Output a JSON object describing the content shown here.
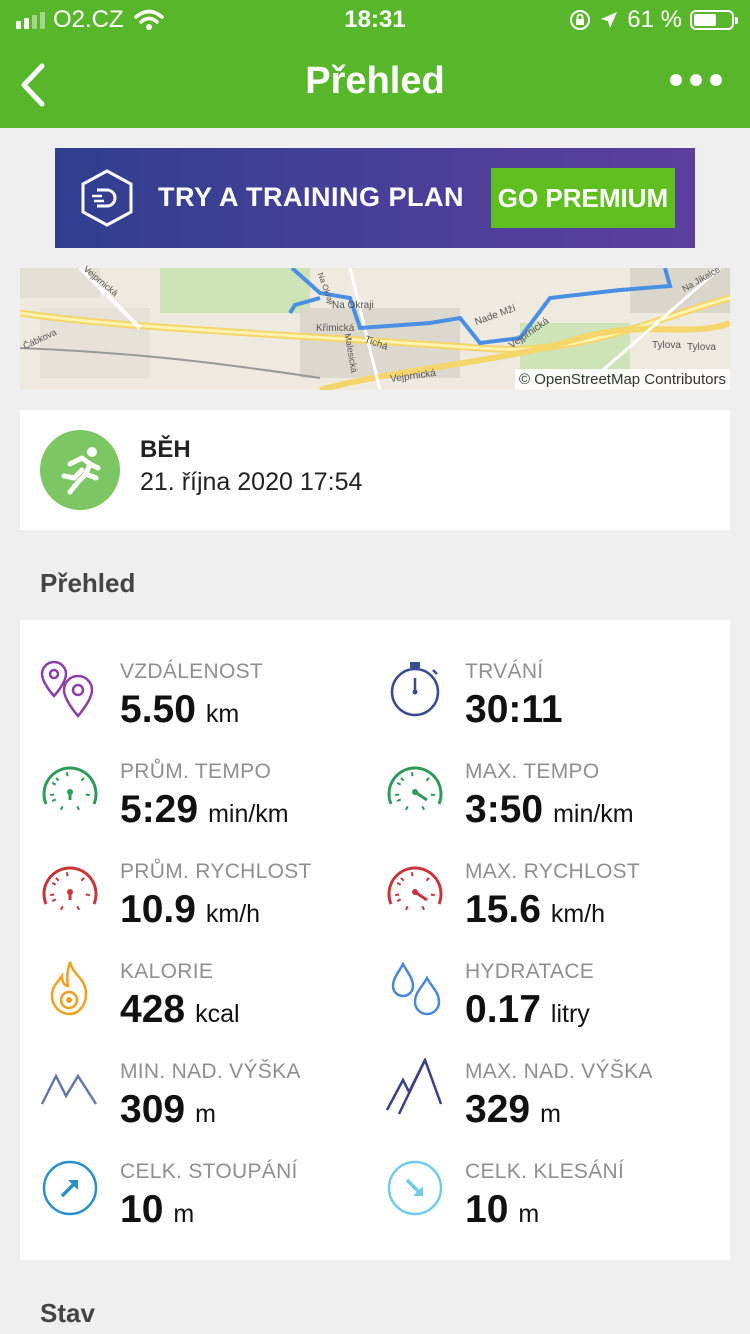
{
  "status_bar": {
    "carrier": "O2.CZ",
    "time": "18:31",
    "battery_percent": "61 %",
    "battery_level": 0.61
  },
  "nav": {
    "title": "Přehled"
  },
  "banner": {
    "text": "TRY A TRAINING PLAN",
    "button": "GO PREMIUM"
  },
  "map": {
    "attribution": "© OpenStreetMap Contributors",
    "streets": [
      "Křimická",
      "Na Okraji",
      "Na Okraji",
      "Malesická",
      "Tichá",
      "Nade Mží",
      "Vejprnická",
      "Vejprnická",
      "Tylova",
      "Tylova",
      "Na Jíkalce",
      "Čábkova",
      "Vejprnická"
    ]
  },
  "activity": {
    "type": "BĚH",
    "datetime": "21. října 2020 17:54"
  },
  "sections": {
    "overview": "Přehled",
    "status": "Stav"
  },
  "stats": [
    {
      "label": "VZDÁLENOST",
      "value": "5.50",
      "unit": "km",
      "icon": "distance-pins-icon",
      "color": "#8a3fa6"
    },
    {
      "label": "TRVÁNÍ",
      "value": "30:11",
      "unit": "",
      "icon": "stopwatch-icon",
      "color": "#3a4a8f"
    },
    {
      "label": "PRŮM. TEMPO",
      "value": "5:29",
      "unit": "min/km",
      "icon": "avg-pace-gauge-icon",
      "color": "#2e9a5a"
    },
    {
      "label": "MAX. TEMPO",
      "value": "3:50",
      "unit": "min/km",
      "icon": "max-pace-gauge-icon",
      "color": "#2e9a5a"
    },
    {
      "label": "PRŮM. RYCHLOST",
      "value": "10.9",
      "unit": "km/h",
      "icon": "avg-speed-gauge-icon",
      "color": "#c9343a"
    },
    {
      "label": "MAX. RYCHLOST",
      "value": "15.6",
      "unit": "km/h",
      "icon": "max-speed-gauge-icon",
      "color": "#c9343a"
    },
    {
      "label": "KALORIE",
      "value": "428",
      "unit": "kcal",
      "icon": "flame-icon",
      "color": "#f0a020"
    },
    {
      "label": "HYDRATACE",
      "value": "0.17",
      "unit": "litry",
      "icon": "water-drops-icon",
      "color": "#4a86d8"
    },
    {
      "label": "MIN. NAD. VÝŠKA",
      "value": "309",
      "unit": "m",
      "icon": "min-elevation-mountains-icon",
      "color": "#6478a8"
    },
    {
      "label": "MAX. NAD. VÝŠKA",
      "value": "329",
      "unit": "m",
      "icon": "max-elevation-mountains-icon",
      "color": "#3a3f8a"
    },
    {
      "label": "CELK. STOUPÁNÍ",
      "value": "10",
      "unit": "m",
      "icon": "ascent-arrow-icon",
      "color": "#2a8fc8"
    },
    {
      "label": "CELK. KLESÁNÍ",
      "value": "10",
      "unit": "m",
      "icon": "descent-arrow-icon",
      "color": "#72cbe8"
    }
  ]
}
